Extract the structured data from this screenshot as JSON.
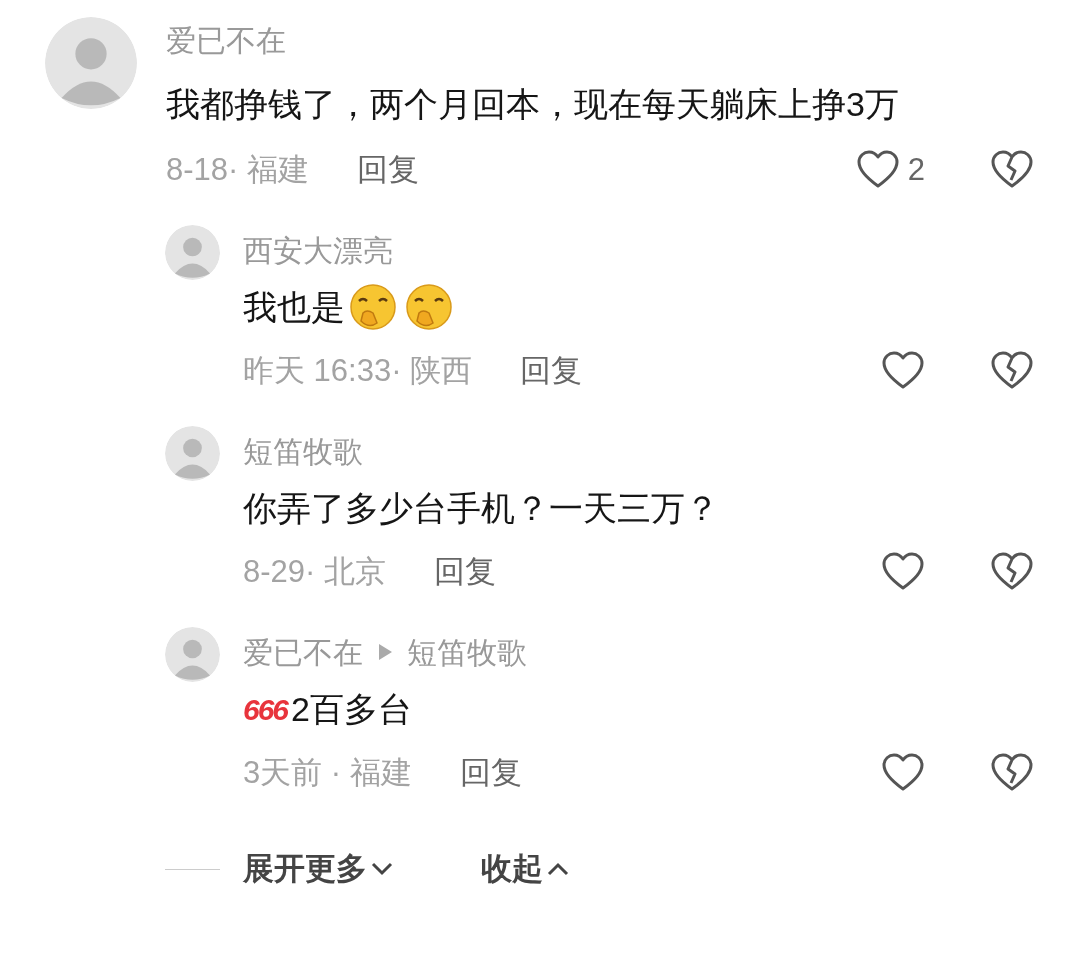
{
  "comment": {
    "user": "爱已不在",
    "text": "我都挣钱了，两个月回本，现在每天躺床上挣3万",
    "meta": "8-18· 福建",
    "reply_label": "回复",
    "likes": "2",
    "replies": [
      {
        "user": "西安大漂亮",
        "parts": [
          {
            "kind": "text",
            "text": "我也是"
          },
          {
            "kind": "emoji"
          },
          {
            "kind": "emoji"
          }
        ],
        "meta": "昨天 16:33· 陕西",
        "reply_label": "回复"
      },
      {
        "user": "短笛牧歌",
        "parts": [
          {
            "kind": "text",
            "text": "你弄了多少台手机？一天三万？"
          }
        ],
        "meta": "8-29· 北京",
        "reply_label": "回复"
      },
      {
        "user": "爱已不在",
        "reply_to": "短笛牧歌",
        "parts": [
          {
            "kind": "sticker",
            "text": "666"
          },
          {
            "kind": "text",
            "text": "2百多台"
          }
        ],
        "meta": "3天前 · 福建",
        "reply_label": "回复"
      }
    ]
  },
  "footer": {
    "expand": "展开更多",
    "collapse": "收起"
  }
}
